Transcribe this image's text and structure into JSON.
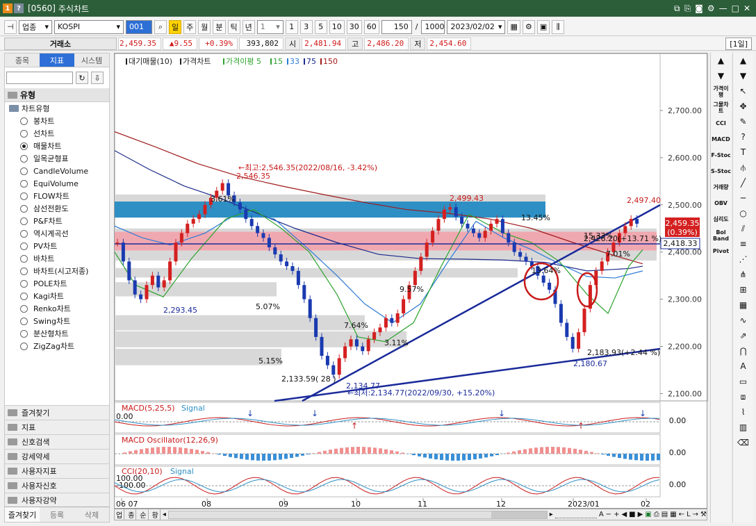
{
  "window": {
    "badges": [
      "1",
      "?"
    ],
    "code": "[0560]",
    "title": "주식차트"
  },
  "toolbar": {
    "sector": "업종",
    "market": "KOSPI",
    "code_box": "001",
    "periods": [
      "일",
      "주",
      "월",
      "분",
      "틱",
      "년"
    ],
    "num_select": "1",
    "minutes": [
      "1",
      "3",
      "5",
      "10",
      "30",
      "60"
    ],
    "count": "150",
    "slash": "/",
    "max": "1000",
    "date": "2023/02/02"
  },
  "info": {
    "title": "거래소",
    "price": "2,459.35",
    "change": "▲9.55",
    "rate": "+0.39%",
    "volume": "393,802",
    "open_label": "시",
    "open": "2,481.94",
    "high_label": "고",
    "high": "2,486.20",
    "low_label": "저",
    "low": "2,454.60",
    "period": "[1일]"
  },
  "sidebar": {
    "tabs": [
      "종목",
      "지표",
      "시스템"
    ],
    "type_group": "유형",
    "chart_type_label": "차트유형",
    "chart_types": [
      "봉차트",
      "선차트",
      "매물차트",
      "일목균형표",
      "CandleVolume",
      "EquiVolume",
      "FLOW차트",
      "삼선전환도",
      "P&F차트",
      "역시계곡선",
      "PV차트",
      "바차트",
      "바차트(시고저종)",
      "POLE차트",
      "Kagi차트",
      "Renko차트",
      "Swing차트",
      "분산형차트",
      "ZigZag차트"
    ],
    "selected": "매물차트",
    "groups": [
      "즐겨찾기",
      "지표",
      "신호검색",
      "강세약세",
      "사용자지표",
      "사용자신호",
      "사용자강약"
    ],
    "foot_tabs": [
      "즐겨찾기",
      "등록",
      "삭제"
    ]
  },
  "legend": {
    "items": [
      "대기매물(10)",
      "가격차트",
      "가격이평 5",
      "15",
      "33",
      "75",
      "150"
    ],
    "colors": [
      "#222222",
      "#222222",
      "#2ea32e",
      "#2ea32e",
      "#2d7bd6",
      "#1a2a8a",
      "#a01a1a"
    ]
  },
  "annotations": {
    "high_label": "2,546.35",
    "high_note": "←최고:2,546.35(2022/08/16, -3.42%)",
    "low_label": "2,134.77",
    "low_note": "←최저:2,134.77(2022/09/30, +15.20%)",
    "label_2499": "2,499.43",
    "label_2497": "2,497.40",
    "label_2293": "2,293.45",
    "label_2180": "2,180.67",
    "trend_label": "2,183.93(+2.44 %)",
    "proj_label": "2,426.20(+13.71 %)",
    "bands_pct": [
      "3.61%",
      "13.45%",
      "15.33%",
      "7.01%",
      "13.64%",
      "5.07%",
      "9.57%",
      "7.64%",
      "3.11%",
      "5.15%"
    ],
    "ll_label": "2,133.59( 28 )",
    "current_price": "2,459.35",
    "current_rate": "(0.39%)",
    "ref_price": "2,418.33"
  },
  "axis": {
    "price_ticks": [
      "2,700.00",
      "2,600.00",
      "2,500.00",
      "2,400.00",
      "2,300.00",
      "2,200.00",
      "2,100.00"
    ],
    "date_labels": [
      "06 07",
      "08",
      "09",
      "10",
      "11",
      "12",
      "2023/01",
      "02"
    ]
  },
  "sub_panels": [
    {
      "title": "MACD(5,25,5)",
      "signal": "Signal",
      "value": "0.00",
      "zero": "0.00"
    },
    {
      "title": "MACD Oscillator(12,26,9)",
      "value": "0.00"
    },
    {
      "title": "CCI(20,10)",
      "signal": "Signal",
      "levels": [
        "100.00",
        "-100.00"
      ],
      "value": "0.00"
    }
  ],
  "right_indicators": [
    "가격이평",
    "그물차트",
    "CCI",
    "MACD",
    "F-Stoc",
    "S-Stoc",
    "거래량",
    "OBV",
    "심리도",
    "Bol Band",
    "Pivot"
  ],
  "bottom": {
    "tabs": [
      "업",
      "종",
      "순",
      "황"
    ],
    "letters": [
      "A",
      "L"
    ]
  }
}
